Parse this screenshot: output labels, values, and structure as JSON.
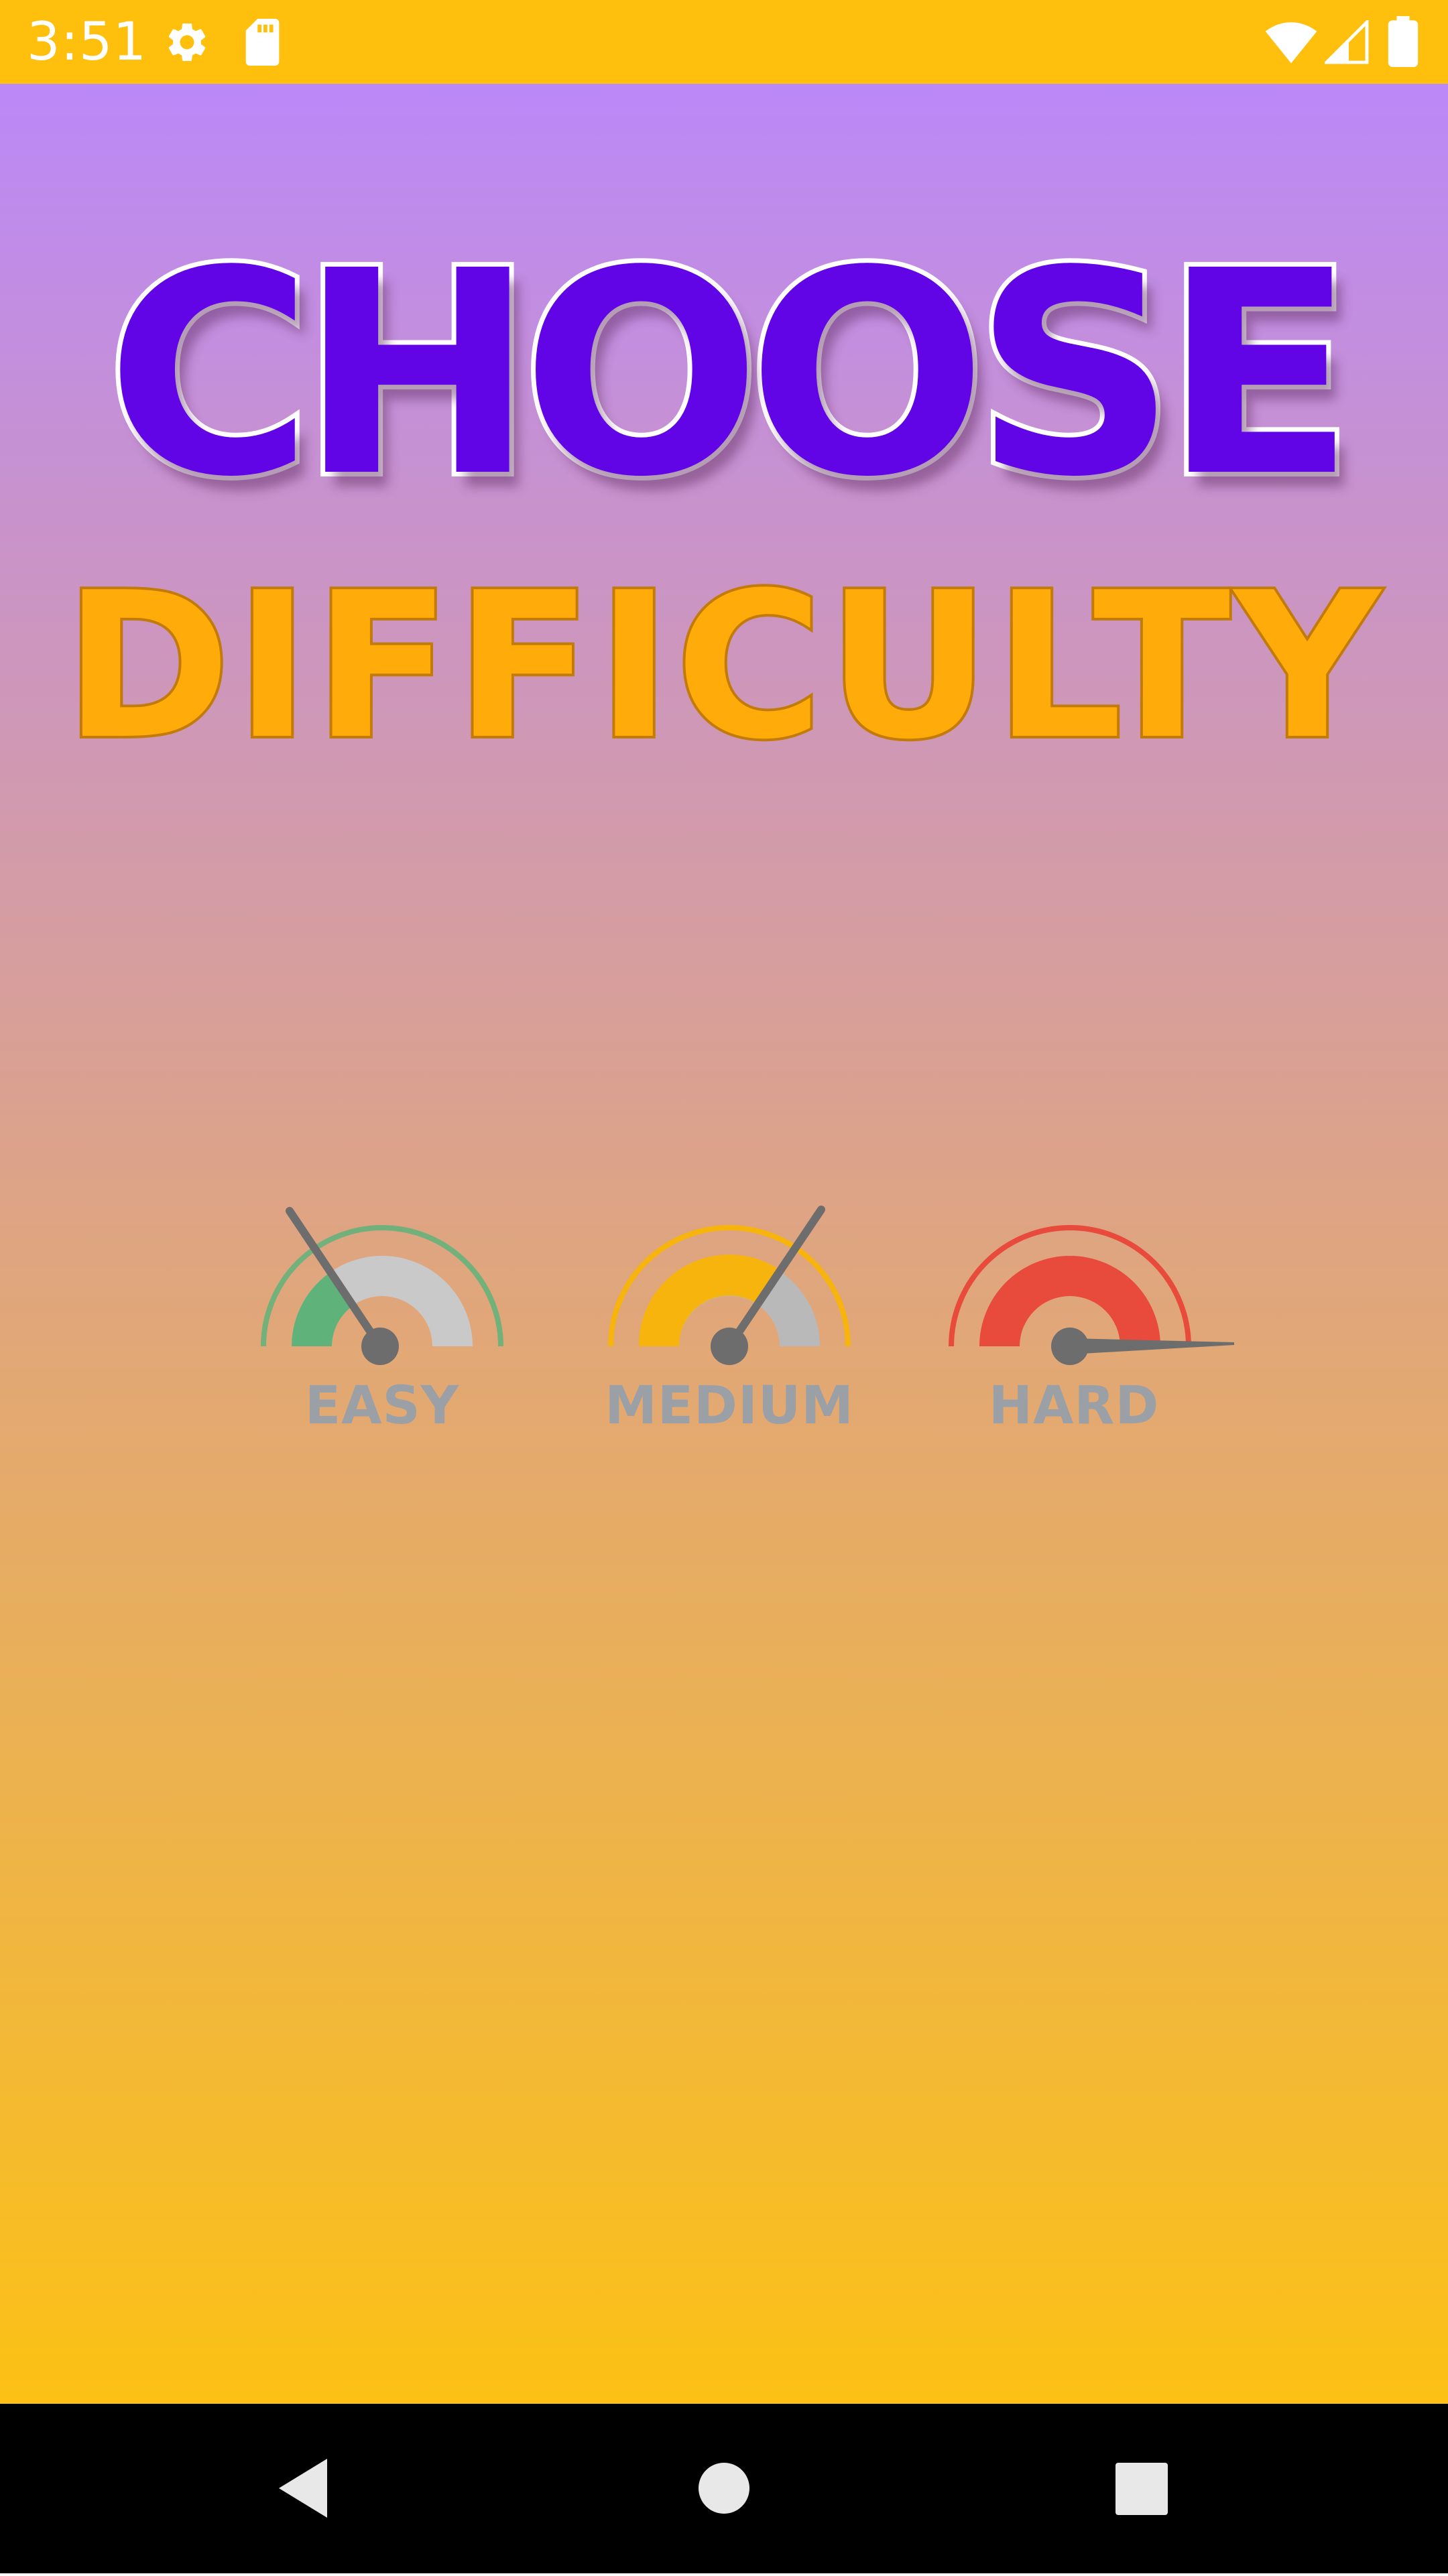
{
  "colors": {
    "status_bar_bg": "#ffc00d",
    "gradient_top": "#bb88f8",
    "gradient_middle": "#e0a67c",
    "gradient_bottom": "#fcc114",
    "choose_fill": "#6205e6",
    "difficulty_fill": "#ffab0a",
    "easy_green": "#5fb37a",
    "medium_yellow": "#f7b40c",
    "hard_red": "#e84a3c",
    "gauge_gray": "#c9c9c9",
    "needle_gray": "#6d6d6d",
    "nav_bar_bg": "#000000"
  },
  "status_bar": {
    "time": "3:51",
    "left_icons": [
      "settings-icon",
      "sd-card-icon"
    ],
    "right_icons": [
      "wifi-icon",
      "cell-signal-icon",
      "battery-icon"
    ]
  },
  "title": {
    "line1": "CHOOSE",
    "line2": "DIFFICULTY"
  },
  "difficulty_options": [
    {
      "label": "EASY",
      "level": 0.33,
      "icon": "speedometer-icon"
    },
    {
      "label": "MEDIUM",
      "level": 0.66,
      "icon": "speedometer-icon"
    },
    {
      "label": "HARD",
      "level": 1.0,
      "icon": "speedometer-icon"
    }
  ],
  "nav_bar": {
    "buttons": [
      "back-icon",
      "home-icon",
      "recents-icon"
    ]
  }
}
